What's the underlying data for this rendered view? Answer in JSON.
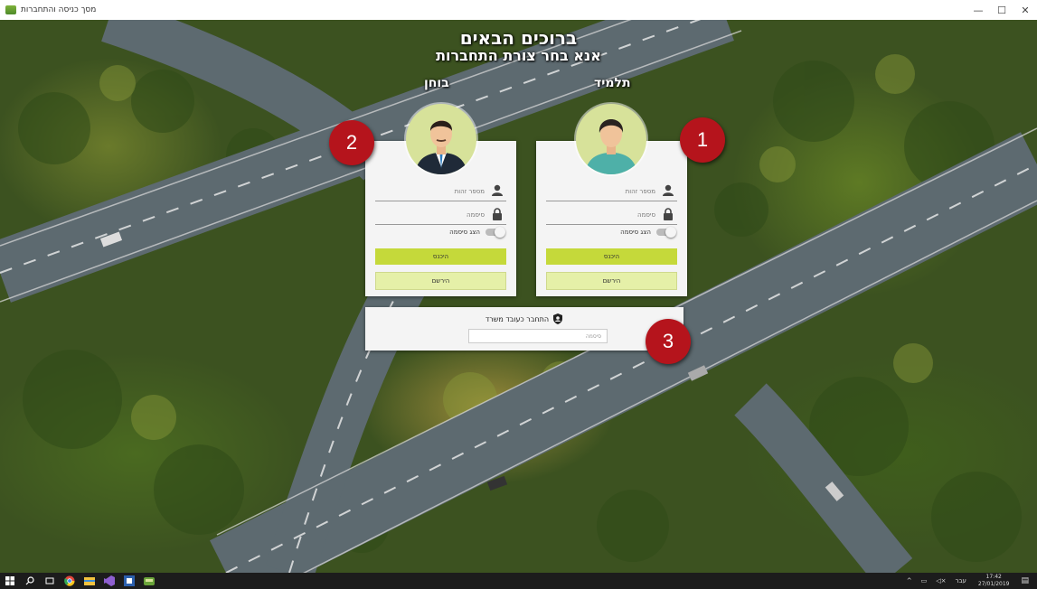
{
  "window": {
    "title": "מסך כניסה והתחברות",
    "controls": [
      "—",
      "☐",
      "✕"
    ]
  },
  "header": {
    "welcome": "ברוכים הבאים",
    "subtitle": "אנא בחר צורת התחברות"
  },
  "student": {
    "label": "תלמיד",
    "id_placeholder": "מספר זהות",
    "password_placeholder": "סיסמה",
    "show_password": "הצג סיסמה",
    "login": "היכנס",
    "register": "הירשם"
  },
  "examiner": {
    "label": "בוחן",
    "id_placeholder": "מספר זהות",
    "password_placeholder": "סיסמה",
    "show_password": "הצג סיסמה",
    "login": "היכנס",
    "register": "הירשם"
  },
  "staff": {
    "title": "התחבר כעובד משרד",
    "password_placeholder": "סיסמה"
  },
  "badges": {
    "b1": "1",
    "b2": "2",
    "b3": "3"
  },
  "taskbar": {
    "lang": "עבר",
    "time": "17:42",
    "date": "27/01/2019"
  },
  "colors": {
    "accent": "#c5d93a",
    "accent_light": "#e5f0a8",
    "badge": "#b5141c",
    "avatar_bg": "#d7e29a"
  },
  "icons": [
    "user-icon",
    "lock-icon",
    "shield-user-icon",
    "windows-start-icon",
    "search-icon",
    "task-view-icon",
    "chrome-icon",
    "file-explorer-icon",
    "visual-studio-icon",
    "word-icon",
    "app-icon"
  ]
}
